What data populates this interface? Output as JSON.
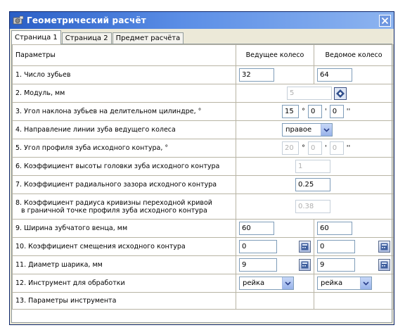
{
  "window": {
    "title": "Геометрический расчёт"
  },
  "tabs": [
    "Страница 1",
    "Страница 2",
    "Предмет расчёта"
  ],
  "table": {
    "headers": {
      "params": "Параметры",
      "driving": "Ведущее колесо",
      "driven": "Ведомое колесо"
    },
    "rows": {
      "teeth": {
        "label": "1. Число зубьев",
        "driving": "32",
        "driven": "64"
      },
      "module": {
        "label": "2. Модуль, мм",
        "value": "5"
      },
      "helix": {
        "label": "3. Угол наклона зубьев на делительном цилиндре, °",
        "deg": "15",
        "min": "0",
        "sec": "0"
      },
      "direction": {
        "label": "4. Направление линии зуба ведущего колеса",
        "value": "правое"
      },
      "profile": {
        "label": "5. Угол профиля зуба исходного контура, °",
        "deg": "20",
        "min": "0",
        "sec": "0"
      },
      "addendum": {
        "label": "6. Коэффициент высоты головки зуба исходного контура",
        "value": "1"
      },
      "clearance": {
        "label": "7. Коэффициент радиального зазора исходного контура",
        "value": "0.25"
      },
      "fillet": {
        "label_line1": "8. Коэффициент радиуса кривизны переходной кривой",
        "label_line2": "в граничной точке профиля зуба исходного контура",
        "value": "0.38"
      },
      "width": {
        "label": "9. Ширина зубчатого венца, мм",
        "driving": "60",
        "driven": "60"
      },
      "shift": {
        "label": "10. Коэффициент смещения исходного контура",
        "driving": "0",
        "driven": "0"
      },
      "ball": {
        "label": "11. Диаметр шарика, мм",
        "driving": "9",
        "driven": "9"
      },
      "tool": {
        "label": "12. Инструмент для обработки",
        "driving": "рейка",
        "driven": "рейка"
      },
      "tool_params": {
        "label": "13. Параметры инструмента"
      }
    }
  }
}
